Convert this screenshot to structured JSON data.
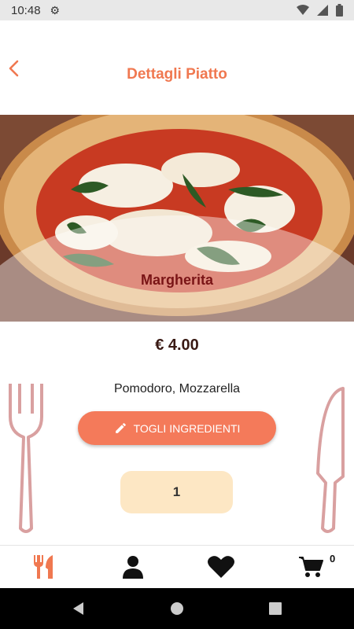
{
  "status_bar": {
    "time": "10:48",
    "icons": [
      "gear-icon",
      "wifi-icon",
      "signal-icon",
      "battery-icon"
    ]
  },
  "header": {
    "title": "Dettagli Piatto",
    "back_icon": "chevron-left-icon"
  },
  "dish": {
    "name": "Margherita",
    "price": "€ 4.00",
    "ingredients": "Pomodoro, Mozzarella",
    "remove_button_label": "TOGLI INGREDIENTI",
    "remove_button_icon": "pencil-icon",
    "quantity": "1"
  },
  "bottom_nav": {
    "items": [
      "cutlery-icon",
      "user-icon",
      "heart-icon",
      "cart-icon"
    ],
    "cart_count": "0",
    "active_item": "cutlery-icon"
  },
  "colors": {
    "accent": "#f07850",
    "dish_name": "#7a1416",
    "quantity_bg": "#fde7c4",
    "decor": "#d9a0a0"
  }
}
